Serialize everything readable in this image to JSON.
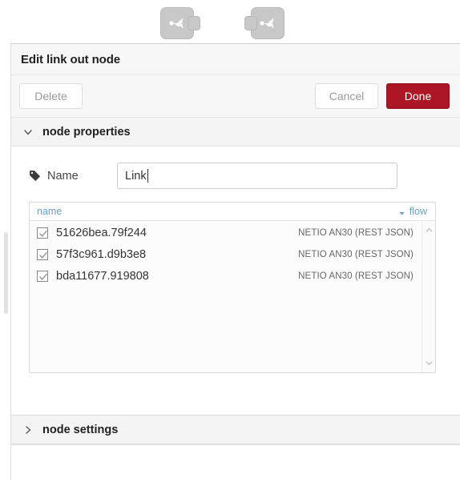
{
  "canvas": {
    "nodes": [
      {
        "id": "node-link-out",
        "icon": "link-out-icon",
        "type": "link out",
        "port_side": "right"
      },
      {
        "id": "node-link-in",
        "icon": "link-in-icon",
        "type": "link in",
        "port_side": "left"
      }
    ]
  },
  "dialog": {
    "title": "Edit link out node",
    "toolbar": {
      "delete_label": "Delete",
      "cancel_label": "Cancel",
      "done_label": "Done",
      "done_color": "#ad1625"
    },
    "sections": {
      "node_properties": {
        "label": "node properties",
        "expanded": true,
        "chevron": "chevron-down-icon"
      },
      "node_settings": {
        "label": "node settings",
        "expanded": false,
        "chevron": "chevron-right-icon"
      }
    },
    "name_field": {
      "icon": "tag-icon",
      "label": "Name",
      "value": "Link",
      "placeholder": "Name",
      "focused": true
    },
    "link_list": {
      "columns": {
        "name": "name",
        "flow": "flow",
        "sort_icon": "sort-caret-down-icon",
        "header_color": "#6aa0c4"
      },
      "rows": [
        {
          "checked": true,
          "name": "51626bea.79f244",
          "flow": "NETIO AN30 (REST JSON)"
        },
        {
          "checked": true,
          "name": "57f3c961.d9b3e8",
          "flow": "NETIO AN30 (REST JSON)"
        },
        {
          "checked": true,
          "name": "bda11677.919808",
          "flow": "NETIO AN30 (REST JSON)"
        }
      ],
      "scrollbar": {
        "up_icon": "chevron-up-icon",
        "down_icon": "chevron-down-icon"
      }
    }
  }
}
